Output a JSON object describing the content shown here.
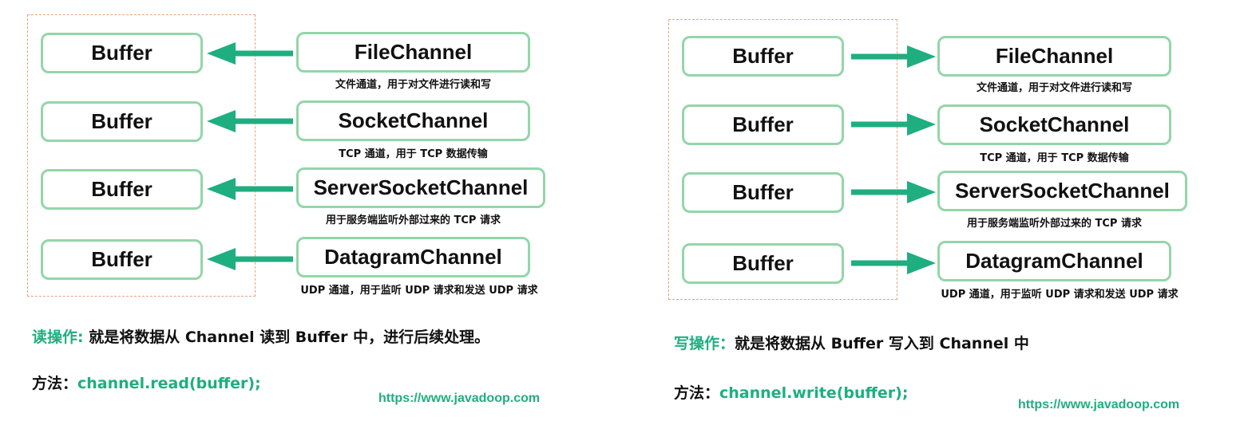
{
  "colors": {
    "accent": "#1fae7f",
    "node_border": "#93d6a9",
    "box_dots": "#e9a27c"
  },
  "buffer_label": "Buffer",
  "channels": [
    {
      "name": "FileChannel",
      "caption": "文件通道，用于对文件进行读和写"
    },
    {
      "name": "SocketChannel",
      "caption": "TCP 通道，用于 TCP 数据传输"
    },
    {
      "name": "ServerSocketChannel",
      "caption": "用于服务端监听外部过来的 TCP 请求"
    },
    {
      "name": "DatagramChannel",
      "caption": "UDP 通道，用于监听 UDP 请求和发送 UDP 请求"
    }
  ],
  "read": {
    "op_label": "读操作:",
    "op_text": " 就是将数据从 Channel 读到 Buffer 中，进行后续处理。",
    "method_label": "方法：",
    "method_code": "channel.read(buffer);",
    "url": "https://www.javadoop.com"
  },
  "write": {
    "op_label": "写操作：",
    "op_text": "就是将数据从 Buffer 写入到 Channel 中",
    "method_label": "方法：",
    "method_code": "channel.write(buffer);",
    "url": "https://www.javadoop.com"
  }
}
